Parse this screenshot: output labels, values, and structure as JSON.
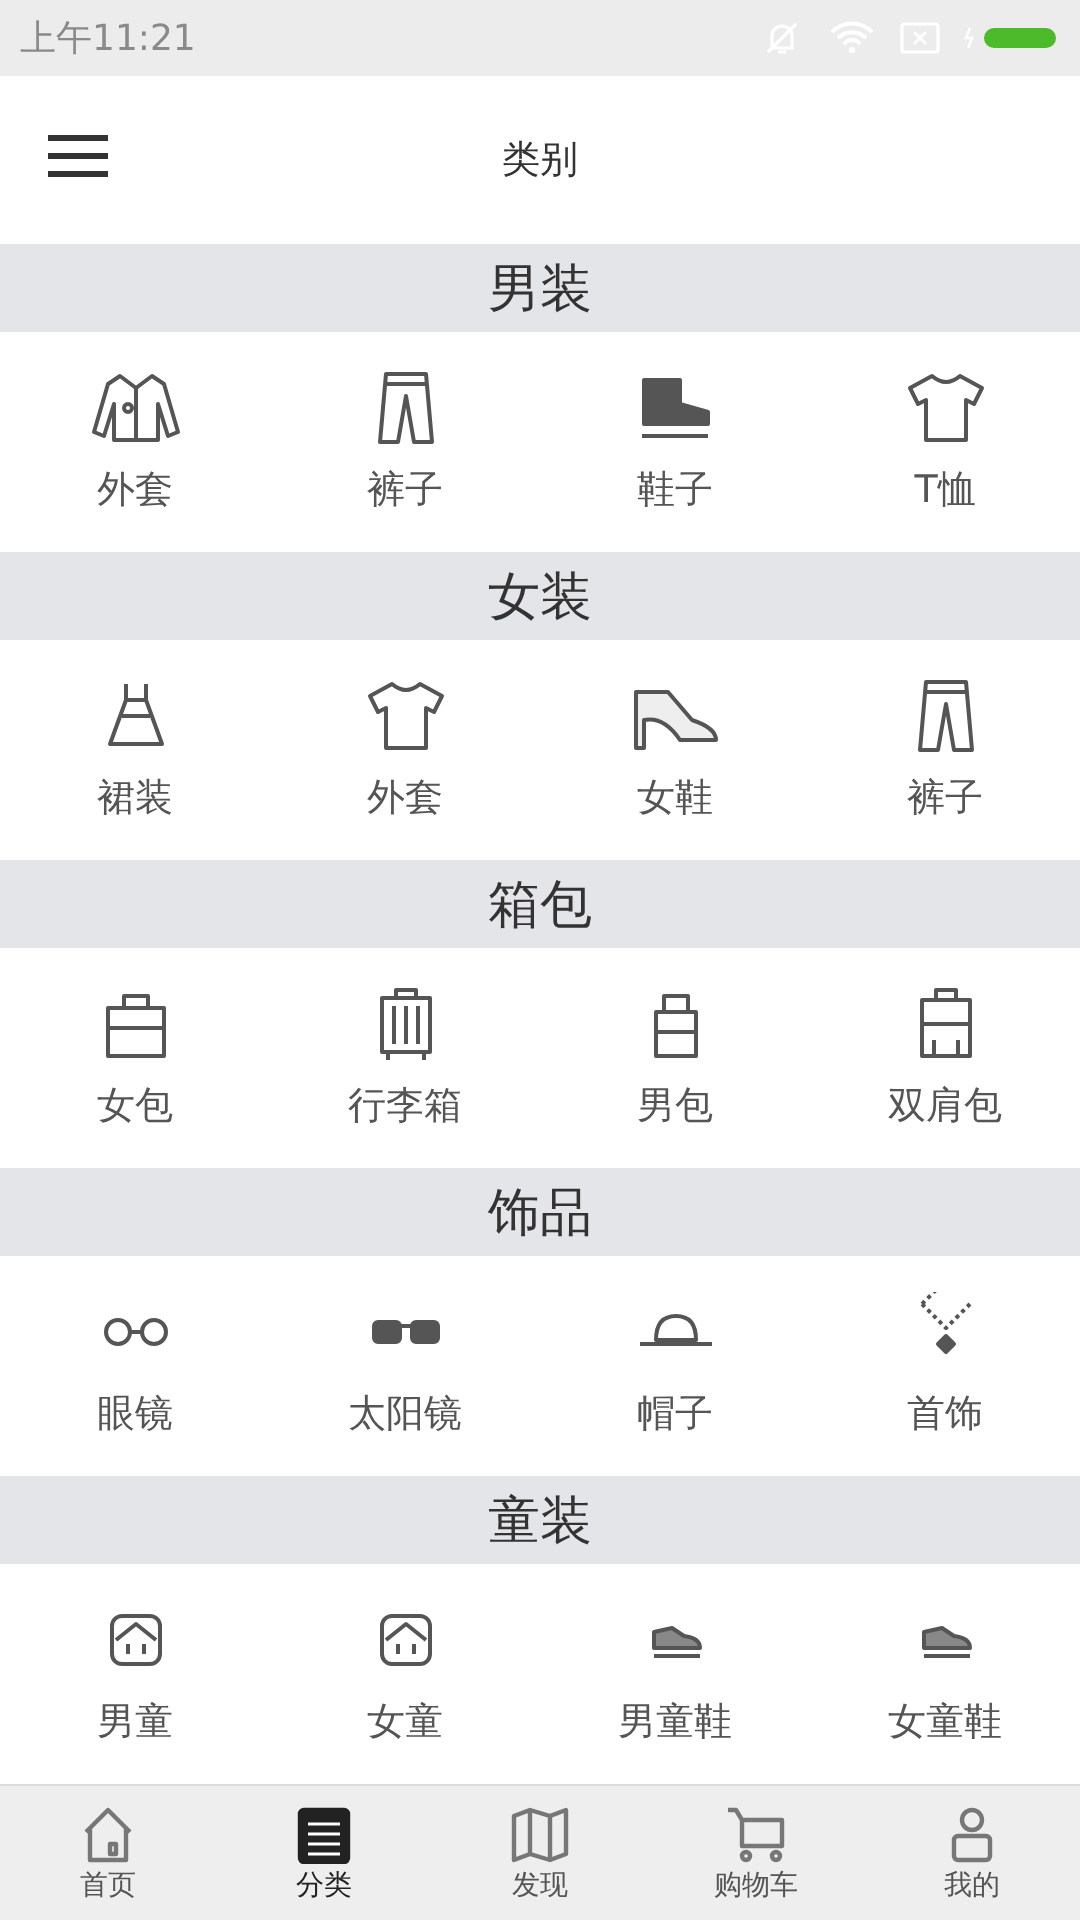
{
  "status_bar": {
    "time": "上午11:21"
  },
  "header": {
    "title": "类别"
  },
  "sections": [
    {
      "title": "男装",
      "items": [
        {
          "label": "外套"
        },
        {
          "label": "裤子"
        },
        {
          "label": "鞋子"
        },
        {
          "label": "T恤"
        }
      ]
    },
    {
      "title": "女装",
      "items": [
        {
          "label": "裙装"
        },
        {
          "label": "外套"
        },
        {
          "label": "女鞋"
        },
        {
          "label": "裤子"
        }
      ]
    },
    {
      "title": "箱包",
      "items": [
        {
          "label": "女包"
        },
        {
          "label": "行李箱"
        },
        {
          "label": "男包"
        },
        {
          "label": "双肩包"
        }
      ]
    },
    {
      "title": "饰品",
      "items": [
        {
          "label": "眼镜"
        },
        {
          "label": "太阳镜"
        },
        {
          "label": "帽子"
        },
        {
          "label": "首饰"
        }
      ]
    },
    {
      "title": "童装",
      "items": [
        {
          "label": "男童"
        },
        {
          "label": "女童"
        },
        {
          "label": "男童鞋"
        },
        {
          "label": "女童鞋"
        }
      ]
    }
  ],
  "tab_bar": [
    {
      "label": "首页",
      "selected": false
    },
    {
      "label": "分类",
      "selected": true
    },
    {
      "label": "发现",
      "selected": false
    },
    {
      "label": "购物车",
      "selected": false
    },
    {
      "label": "我的",
      "selected": false
    }
  ]
}
